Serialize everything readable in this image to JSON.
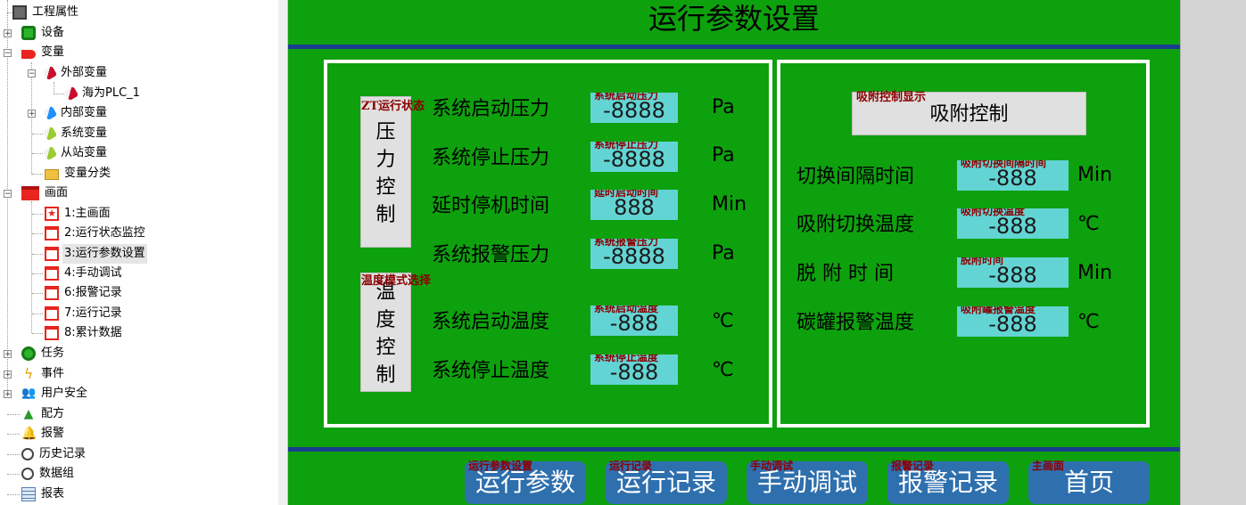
{
  "tree": {
    "items": [
      {
        "label": "工程属性"
      },
      {
        "label": "设备"
      },
      {
        "label": "变量"
      },
      {
        "label": "外部变量"
      },
      {
        "label": "海为PLC_1"
      },
      {
        "label": "内部变量"
      },
      {
        "label": "系统变量"
      },
      {
        "label": "从站变量"
      },
      {
        "label": "变量分类"
      },
      {
        "label": "画面"
      },
      {
        "label": "1:主画面"
      },
      {
        "label": "2:运行状态监控"
      },
      {
        "label": "3:运行参数设置"
      },
      {
        "label": "4:手动调试"
      },
      {
        "label": "6:报警记录"
      },
      {
        "label": "7:运行记录"
      },
      {
        "label": "8:累计数据"
      },
      {
        "label": "任务"
      },
      {
        "label": "事件"
      },
      {
        "label": "用户安全"
      },
      {
        "label": "配方"
      },
      {
        "label": "报警"
      },
      {
        "label": "历史记录"
      },
      {
        "label": "数据组"
      },
      {
        "label": "报表"
      }
    ],
    "selected": "3:运行参数设置"
  },
  "screen": {
    "title": "运行参数设置",
    "colors": {
      "background": "#0ea10e",
      "divider": "#1a3d8f",
      "value_box": "#63d4d4",
      "nav_button": "#2e6fae",
      "tag_text": "#8b0000"
    },
    "left_panel": {
      "pressure_button": {
        "label": "压\n力\n控\n制",
        "tag": "ZT运行状态"
      },
      "temp_button": {
        "label": "温\n度\n控\n制",
        "tag": "温度模式选择"
      },
      "rows": [
        {
          "label": "系统启动压力",
          "tag": "系统启动压力",
          "value": "-8888",
          "unit": "Pa"
        },
        {
          "label": "系统停止压力",
          "tag": "系统停止压力",
          "value": "-8888",
          "unit": "Pa"
        },
        {
          "label": "延时停机时间",
          "tag": "延时启动时间",
          "value": "888",
          "unit": "Min"
        },
        {
          "label": "系统报警压力",
          "tag": "系统报警压力",
          "value": "-8888",
          "unit": "Pa"
        },
        {
          "label": "系统启动温度",
          "tag": "系统启动温度",
          "value": "-888",
          "unit": "℃"
        },
        {
          "label": "系统停止温度",
          "tag": "系统停止温度",
          "value": "-888",
          "unit": "℃"
        }
      ]
    },
    "right_panel": {
      "button": {
        "label": "吸附控制",
        "tag": "吸附控制显示"
      },
      "rows": [
        {
          "label": "切换间隔时间",
          "tag": "吸附切换间隔时间",
          "value": "-888",
          "unit": "Min"
        },
        {
          "label": "吸附切换温度",
          "tag": "吸附切换温度",
          "value": "-888",
          "unit": "℃"
        },
        {
          "label": "脱 附 时 间",
          "tag": "脱附时间",
          "value": "-888",
          "unit": "Min"
        },
        {
          "label": "碳罐报警温度",
          "tag": "吸附罐报警温度",
          "value": "-888",
          "unit": "℃"
        }
      ]
    },
    "nav": [
      {
        "label": "运行参数",
        "tag": "运行参数设置"
      },
      {
        "label": "运行记录",
        "tag": "运行记录"
      },
      {
        "label": "手动调试",
        "tag": "手动调试"
      },
      {
        "label": "报警记录",
        "tag": "报警记录"
      },
      {
        "label": "首页",
        "tag": "主画面"
      }
    ]
  }
}
